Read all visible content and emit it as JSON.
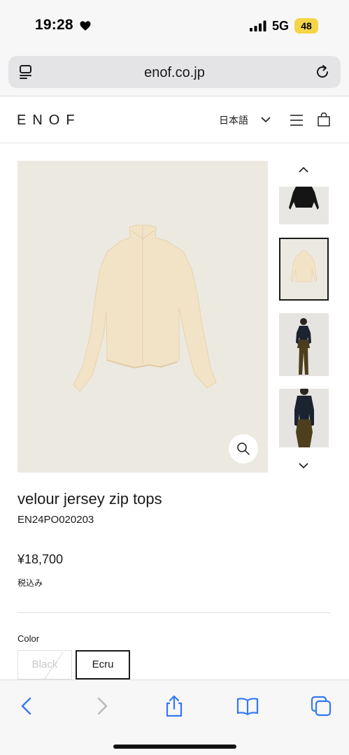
{
  "status_bar": {
    "time": "19:28",
    "network": "5G",
    "battery": "48"
  },
  "browser": {
    "url": "enof.co.jp"
  },
  "site": {
    "logo": "ENOF",
    "language": "日本語"
  },
  "product": {
    "name": "velour jersey zip tops",
    "code": "EN24PO020203",
    "price": "¥18,700",
    "tax_note": "税込み",
    "color_label": "Color",
    "colors": [
      {
        "label": "Black",
        "available": false
      },
      {
        "label": "Ecru",
        "available": true,
        "selected": true
      }
    ]
  },
  "icons": {
    "heart": "heart-icon",
    "tabs": "reader-icon",
    "reload": "reload-icon",
    "chevron": "chevron-down-icon",
    "menu": "hamburger-menu-icon",
    "bag": "shopping-bag-icon",
    "zoom": "magnifier-icon",
    "share": "share-icon",
    "bookmarks": "book-icon"
  },
  "colors": {
    "image_background": "#ece9e1",
    "garment": "#f3e3c6",
    "battery": "#f5d547",
    "ios_blue": "#3478f6"
  }
}
